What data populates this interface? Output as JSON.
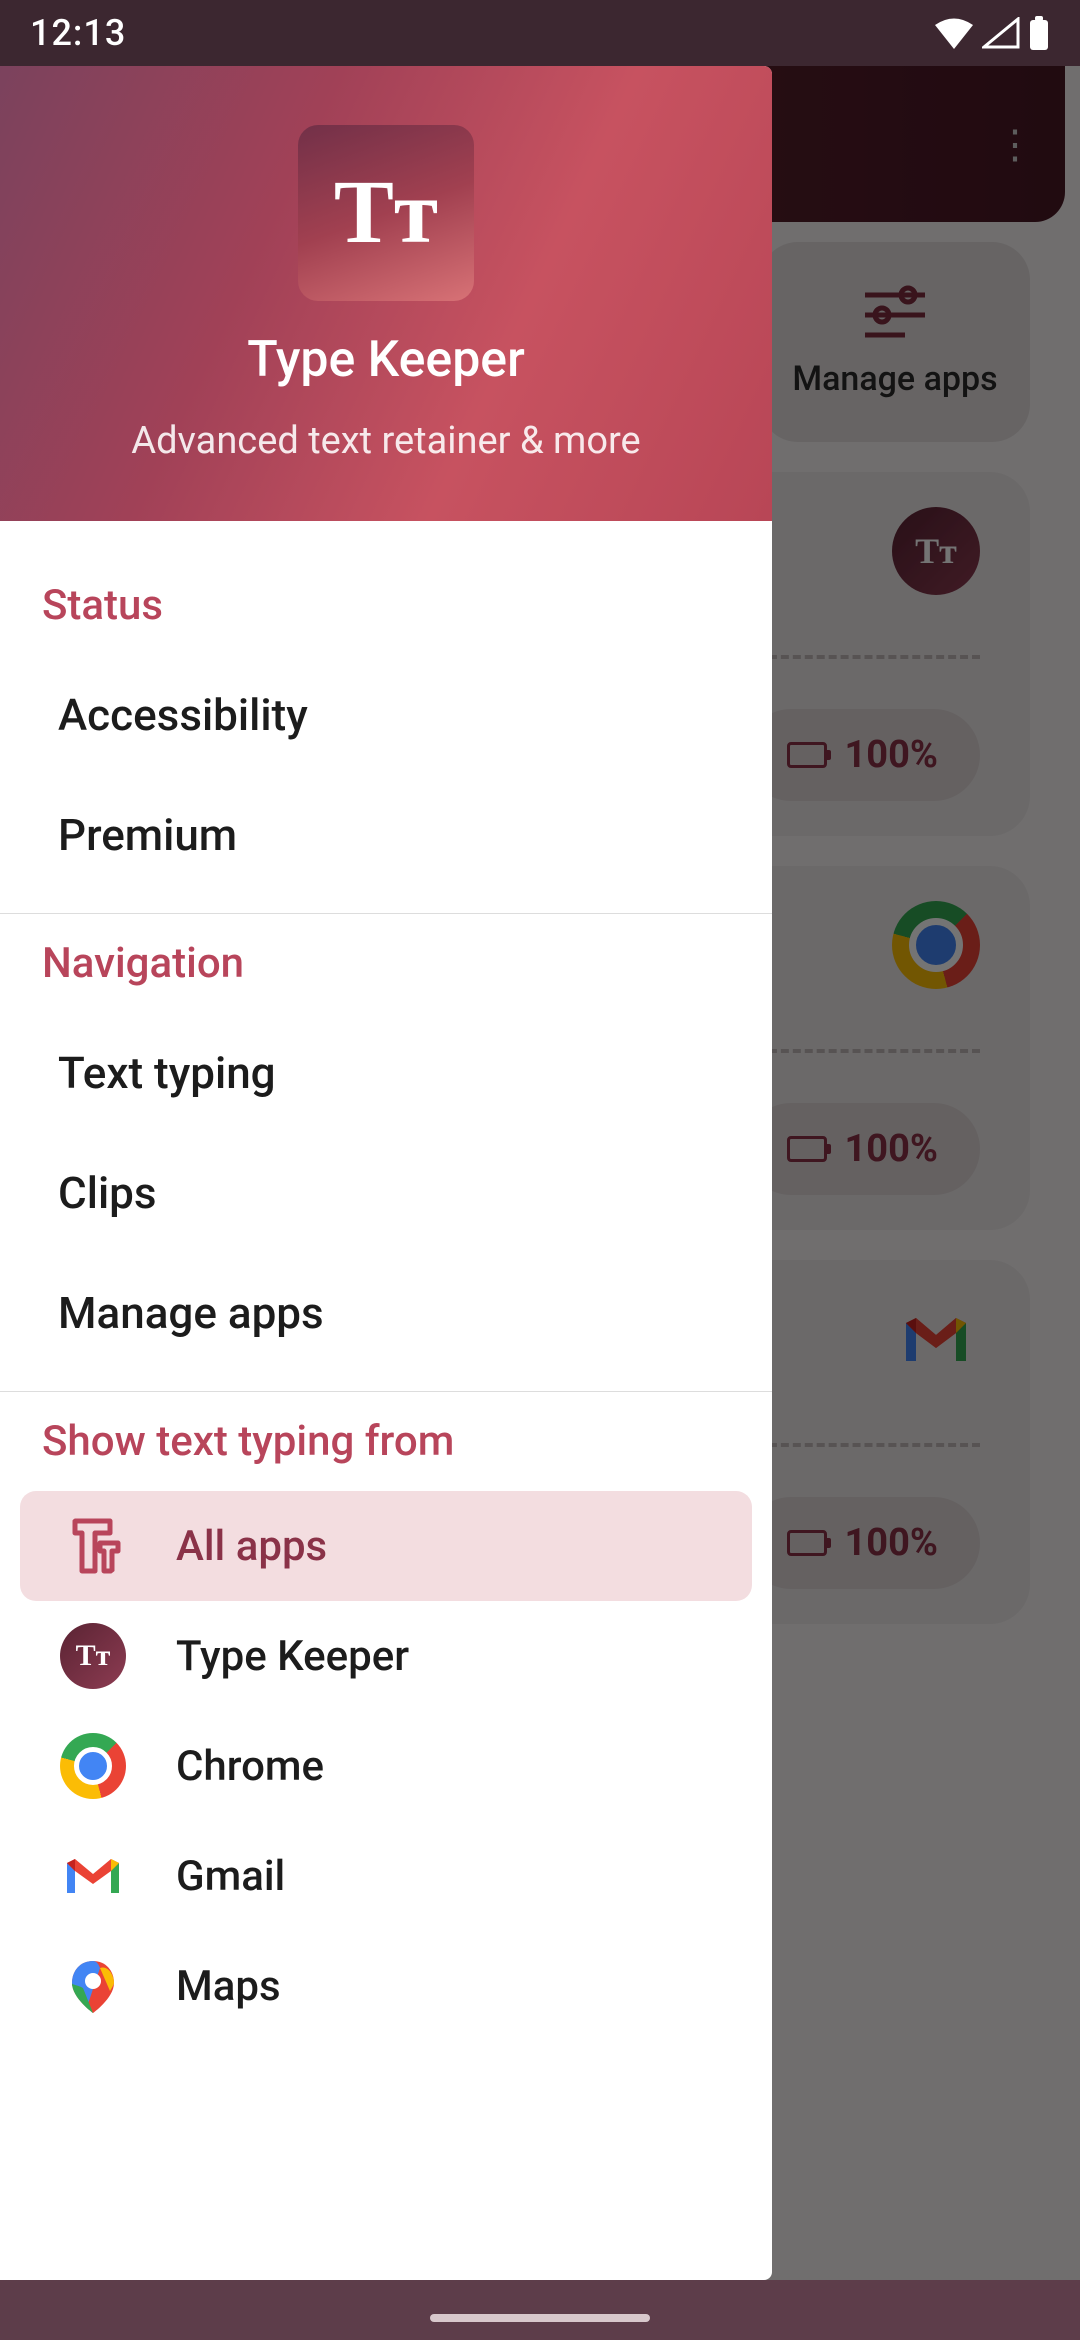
{
  "statusBar": {
    "time": "12:13"
  },
  "backgroundScreen": {
    "tile": {
      "label": "Manage apps"
    },
    "cards": [
      {
        "percent": "100%"
      },
      {
        "percent": "100%"
      },
      {
        "percent": "100%"
      }
    ]
  },
  "drawer": {
    "header": {
      "title": "Type Keeper",
      "subtitle": "Advanced text retainer & more",
      "logoText": "Tᴛ"
    },
    "sections": {
      "status": {
        "header": "Status",
        "items": [
          {
            "label": "Accessibility"
          },
          {
            "label": "Premium"
          }
        ]
      },
      "navigation": {
        "header": "Navigation",
        "items": [
          {
            "label": "Text typing"
          },
          {
            "label": "Clips"
          },
          {
            "label": "Manage apps"
          }
        ]
      },
      "apps": {
        "header": "Show text typing from",
        "items": [
          {
            "label": "All apps",
            "selected": true,
            "icon": "all-apps"
          },
          {
            "label": "Type Keeper",
            "icon": "type-keeper"
          },
          {
            "label": "Chrome",
            "icon": "chrome"
          },
          {
            "label": "Gmail",
            "icon": "gmail"
          },
          {
            "label": "Maps",
            "icon": "maps"
          }
        ]
      }
    }
  }
}
